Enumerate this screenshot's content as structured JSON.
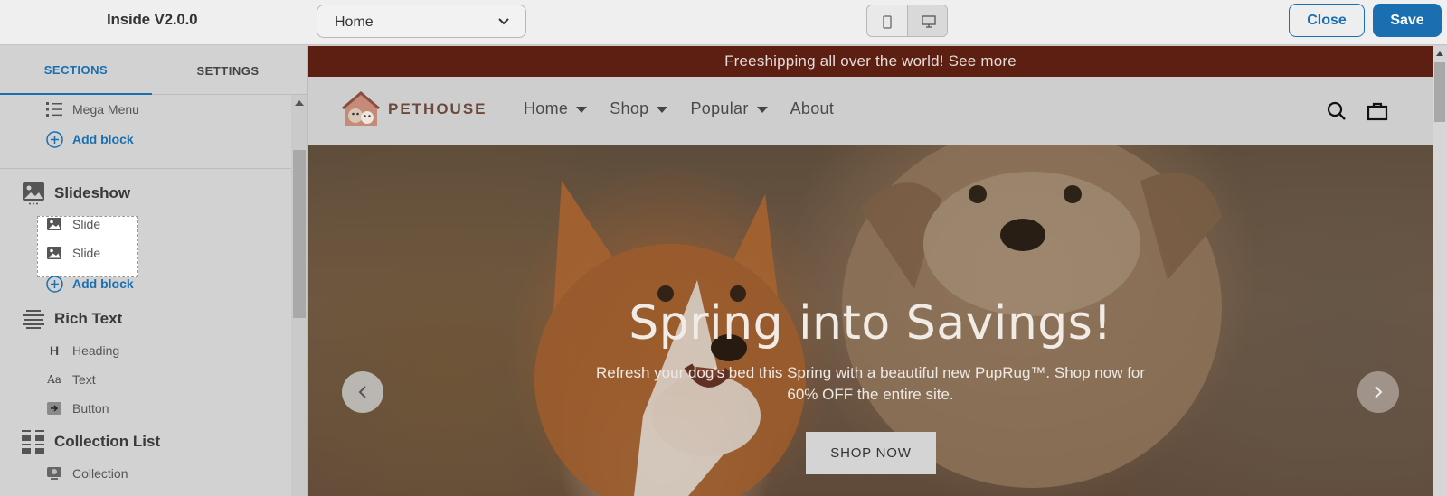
{
  "topbar": {
    "app_title": "Inside V2.0.0",
    "page_select_value": "Home",
    "close_label": "Close",
    "save_label": "Save",
    "accent_color": "#1a6fb0"
  },
  "sidebar": {
    "tabs": [
      "SECTIONS",
      "SETTINGS"
    ],
    "mega_menu_block": "Mega Menu",
    "add_block_label": "Add block",
    "slideshow": {
      "title": "Slideshow",
      "blocks": [
        "Slide",
        "Slide"
      ]
    },
    "rich_text": {
      "title": "Rich Text",
      "blocks": [
        "Heading",
        "Text",
        "Button"
      ]
    },
    "collection_list": {
      "title": "Collection List",
      "blocks": [
        "Collection"
      ]
    }
  },
  "preview": {
    "announcement": "Freeshipping all over the world! See more",
    "announcement_color": "#5c1f12",
    "logo_text": "PETHOUSE",
    "nav": [
      "Home",
      "Shop",
      "Popular",
      "About"
    ],
    "hero": {
      "title": "Spring into Savings!",
      "subtitle": "Refresh your dog's bed this Spring with a beautiful new PupRug™. Shop now for 60% OFF the entire site.",
      "cta": "SHOP NOW"
    }
  }
}
